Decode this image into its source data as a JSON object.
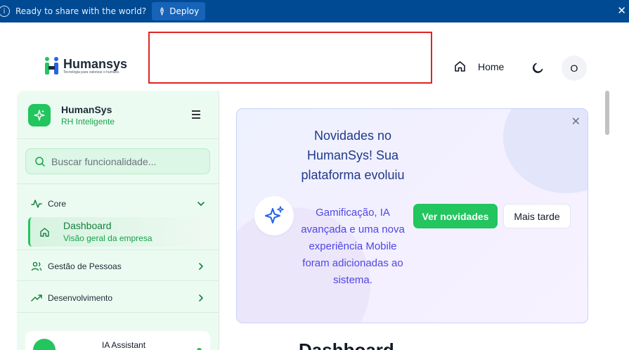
{
  "deploy_bar": {
    "message": "Ready to share with the world?",
    "deploy_label": "Deploy",
    "close_glyph": "✕"
  },
  "header": {
    "logo_name": "Humansys",
    "logo_tagline": "Tecnologia para valorizar o humano.",
    "home_label": "Home",
    "avatar_initial": "O"
  },
  "sidebar": {
    "app_name": "HumanSys",
    "app_subtitle": "RH Inteligente",
    "search_placeholder": "Buscar funcionalidade...",
    "groups": [
      {
        "label": "Core"
      },
      {
        "label": "Gestão de Pessoas"
      },
      {
        "label": "Desenvolvimento"
      }
    ],
    "active_item": {
      "label": "Dashboard",
      "subtitle": "Visão geral da empresa"
    },
    "assistant_label": "IA Assistant"
  },
  "banner": {
    "title": "Novidades no HumanSys! Sua plataforma evoluiu",
    "description": "Gamificação, IA avançada e uma nova experiência Mobile foram adicionadas ao sistema.",
    "primary_button": "Ver novidades",
    "secondary_button": "Mais tarde",
    "close_glyph": "✕"
  },
  "main": {
    "page_title": "Dashboard"
  },
  "colors": {
    "deploy_bar": "#004a94",
    "brand_green": "#22c55e",
    "banner_title": "#1e3a8a",
    "banner_text": "#4f46e5"
  }
}
